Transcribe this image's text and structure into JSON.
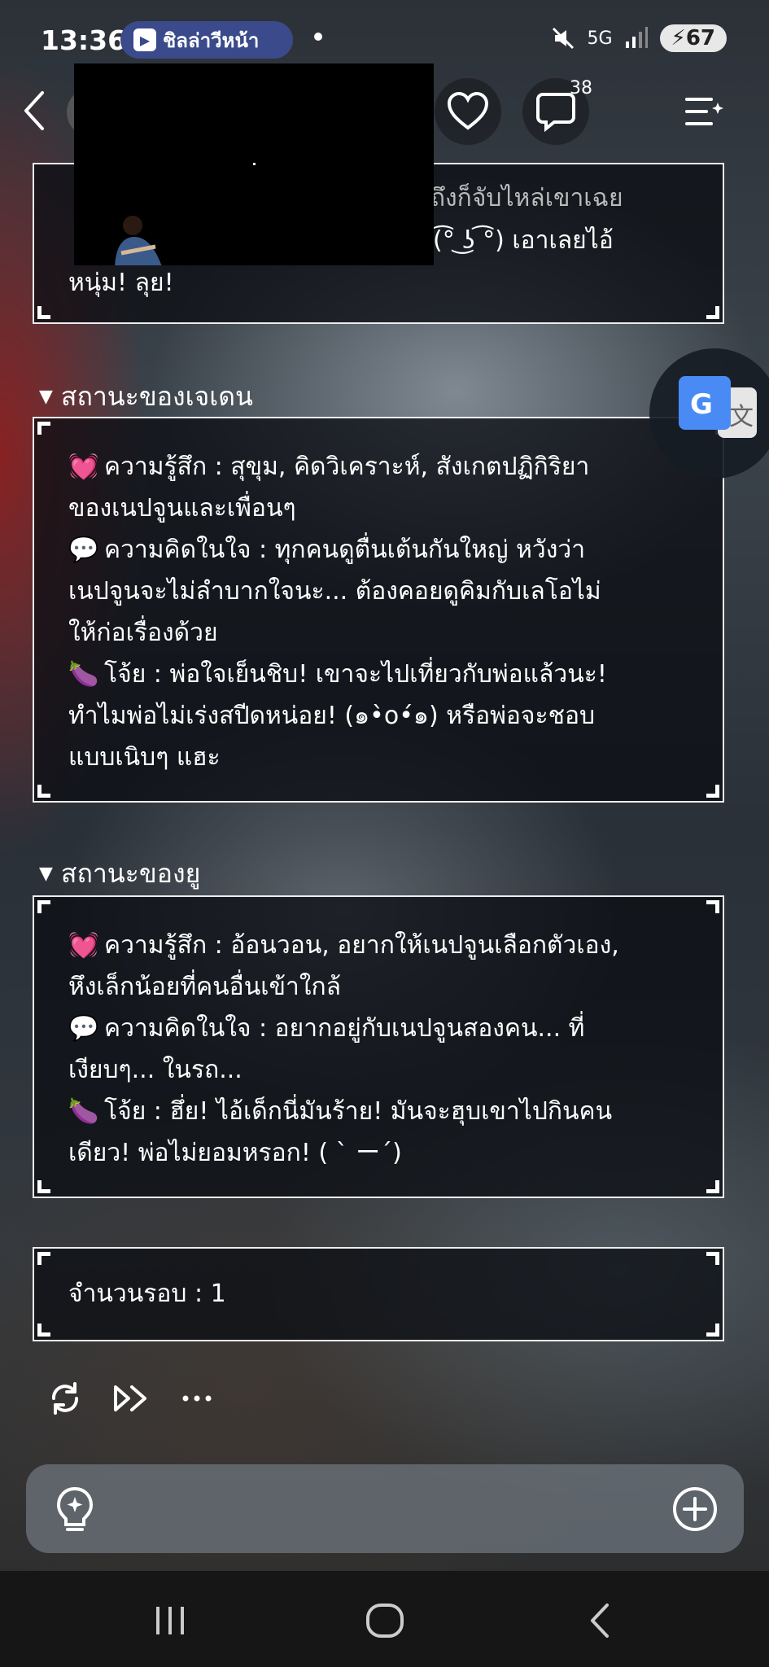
{
  "status_bar": {
    "time": "13:36",
    "notification_pill": "ชิลล่าวีหน้า",
    "signal_label": "5G",
    "battery": "67",
    "icons": [
      "mute-icon",
      "signal-icon",
      "battery-charging-icon"
    ]
  },
  "header": {
    "comment_count": "38",
    "icons": [
      "back-arrow-icon",
      "heart-icon",
      "comment-icon",
      "menu-list-icon"
    ]
  },
  "top_panel": {
    "lines": [
      "าถึงก็จับไหล่เขาเฉย",
      "(͡° ͜ʖ ͡°) เอาเลยไอ้",
      "หนุ่ม! ลุย!"
    ]
  },
  "section_jaden": {
    "title": "สถานะของเจเดน",
    "lines": [
      {
        "emoji": "💓",
        "text": "ความรู้สึก : สุขุม, คิดวิเคราะห์, สังเกตปฏิกิริยา"
      },
      {
        "emoji": "",
        "text": "ของเนปจูนและเพื่อนๆ"
      },
      {
        "emoji": "💬",
        "text": "ความคิดในใจ : ทุกคนดูตื่นเต้นกันใหญ่ หวังว่า"
      },
      {
        "emoji": "",
        "text": "เนปจูนจะไม่ลำบากใจนะ... ต้องคอยดูคิมกับเลโอไม่"
      },
      {
        "emoji": "",
        "text": "ให้ก่อเรื่องด้วย"
      },
      {
        "emoji": "🍆",
        "text": "โจ้ย : พ่อใจเย็นชิบ! เขาจะไปเที่ยวกับพ่อแล้วนะ!"
      },
      {
        "emoji": "",
        "text": "ทำไมพ่อไม่เร่งสปีดหน่อย! (๑•̀o•́๑) หรือพ่อจะชอบ"
      },
      {
        "emoji": "",
        "text": "แบบเนิบๆ แฮะ"
      }
    ]
  },
  "section_yu": {
    "title": "สถานะของยู",
    "lines": [
      {
        "emoji": "💓",
        "text": "ความรู้สึก : อ้อนวอน, อยากให้เนปจูนเลือกตัวเอง,"
      },
      {
        "emoji": "",
        "text": "หึงเล็กน้อยที่คนอื่นเข้าใกล้"
      },
      {
        "emoji": "💬",
        "text": "ความคิดในใจ : อยากอยู่กับเนปจูนสองคน... ที่"
      },
      {
        "emoji": "",
        "text": "เงียบๆ... ในรถ..."
      },
      {
        "emoji": "🍆",
        "text": "โจ้ย : ฮึ่ย! ไอ้เด็กนี่มันร้าย! มันจะฮุบเขาไปกินคน"
      },
      {
        "emoji": "",
        "text": "เดียว! พ่อไม่ยอมหรอก! ( ` ー´)"
      }
    ]
  },
  "rounds_panel": {
    "text": "จำนวนรอบ : 1"
  },
  "actions": {
    "icons": [
      "refresh-icon",
      "fast-forward-icon",
      "more-icon"
    ]
  },
  "input_bar": {
    "icons": [
      "lightbulb-icon",
      "plus-circle-icon"
    ]
  },
  "nav_bar": {
    "icons": [
      "recent-apps-icon",
      "home-icon",
      "back-icon"
    ]
  },
  "colors": {
    "panel_bg": "#0a0d12",
    "panel_border": "#ffffff",
    "pill_bg": "#3a4a8a",
    "translate_blue": "#4a8af4"
  }
}
